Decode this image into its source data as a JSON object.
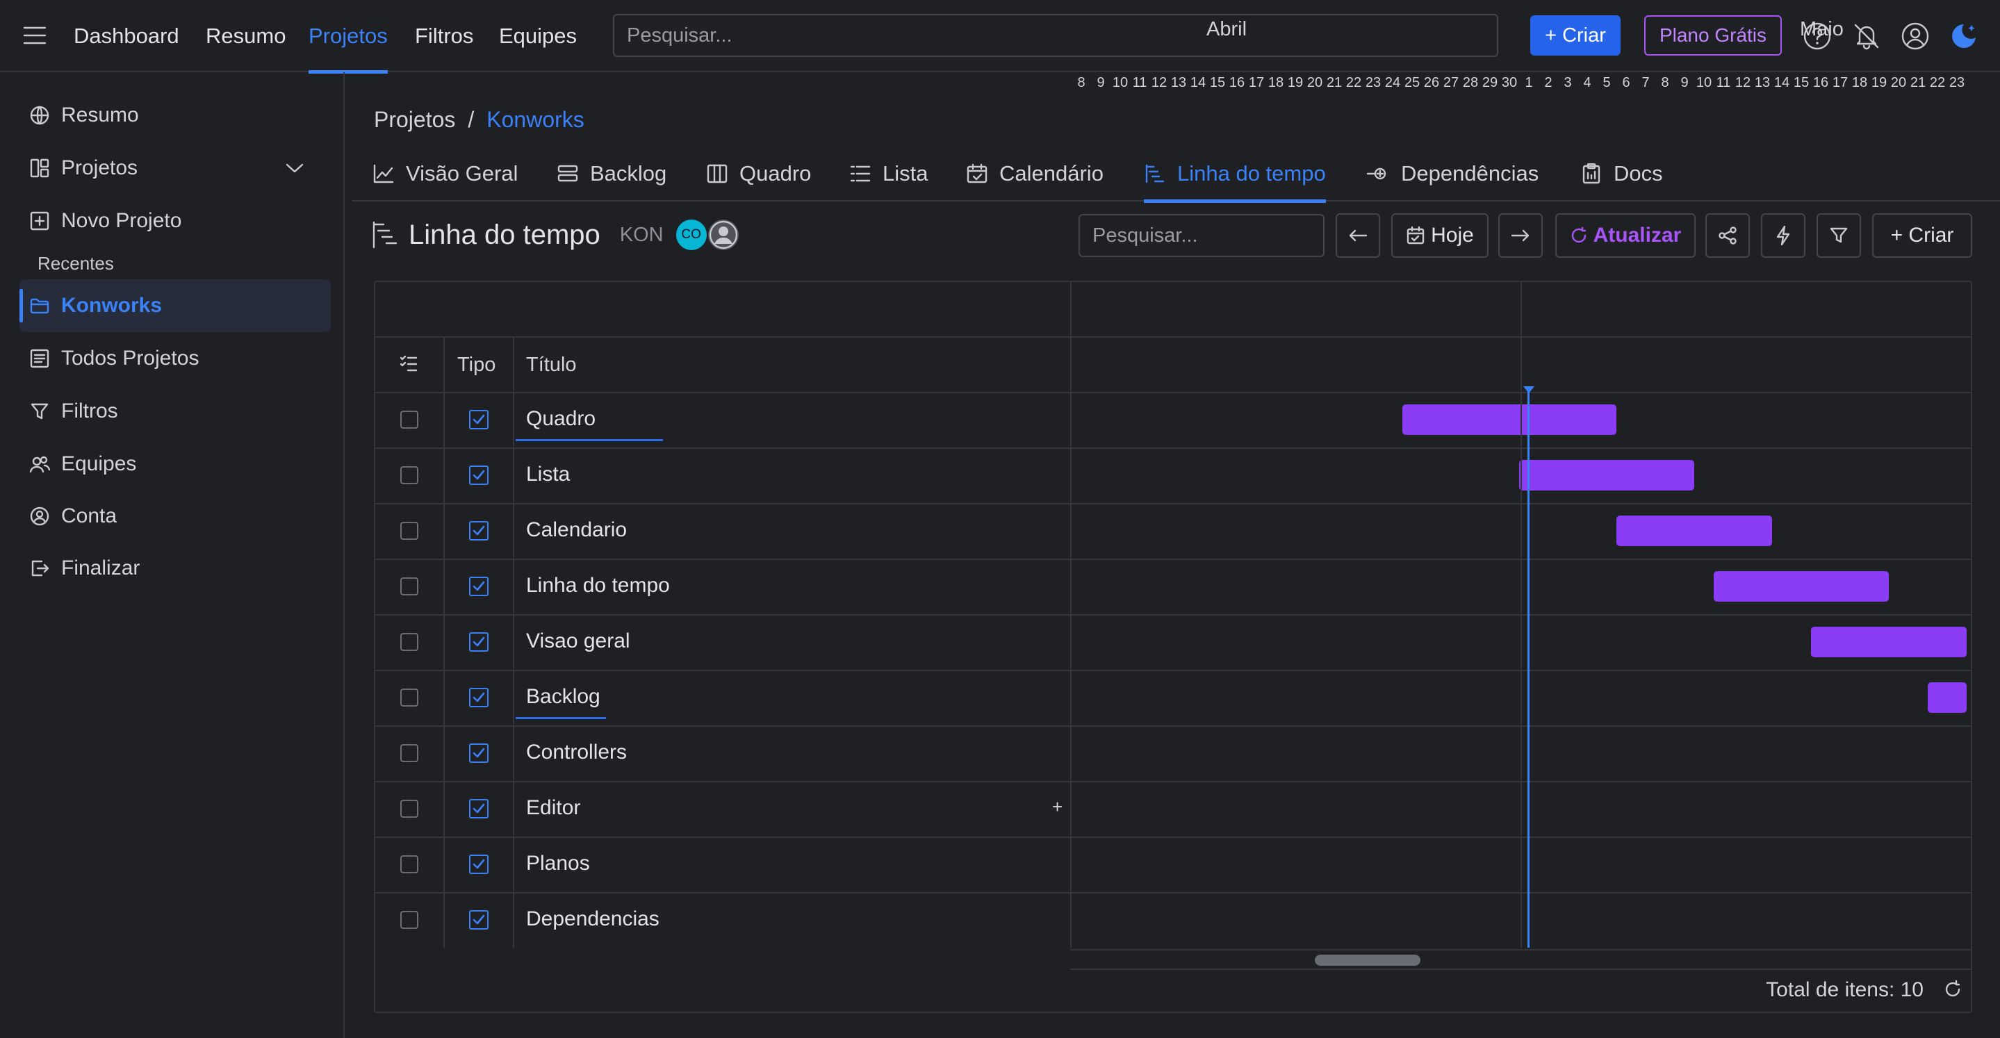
{
  "topbar": {
    "nav": [
      "Dashboard",
      "Resumo",
      "Projetos",
      "Filtros",
      "Equipes"
    ],
    "active_nav": "Projetos",
    "search_placeholder": "Pesquisar...",
    "create_label": "+ Criar",
    "plan_label": "Plano Grátis",
    "icons": [
      "help-icon",
      "notifications-off-icon",
      "user-icon",
      "theme-toggle-icon"
    ]
  },
  "sidebar": {
    "items": [
      {
        "label": "Resumo",
        "icon": "globe-icon"
      },
      {
        "label": "Projetos",
        "icon": "layout-icon"
      },
      {
        "label": "Novo Projeto",
        "icon": "plus-square-icon"
      },
      {
        "label": "Konworks",
        "icon": "folder-icon",
        "active": true
      },
      {
        "label": "Todos Projetos",
        "icon": "list-icon"
      },
      {
        "label": "Filtros",
        "icon": "filter-icon"
      },
      {
        "label": "Equipes",
        "icon": "users-icon"
      },
      {
        "label": "Conta",
        "icon": "user-circle-icon"
      },
      {
        "label": "Finalizar",
        "icon": "logout-icon"
      }
    ],
    "section_recentes": "Recentes"
  },
  "breadcrumb": {
    "root": "Projetos",
    "separator": "/",
    "current": "Konworks"
  },
  "tabs": [
    {
      "label": "Visão Geral",
      "icon": "chart-icon"
    },
    {
      "label": "Backlog",
      "icon": "backlog-icon"
    },
    {
      "label": "Quadro",
      "icon": "columns-icon"
    },
    {
      "label": "Lista",
      "icon": "list-icon"
    },
    {
      "label": "Calendário",
      "icon": "calendar-icon"
    },
    {
      "label": "Linha do tempo",
      "icon": "timeline-icon",
      "active": true
    },
    {
      "label": "Dependências",
      "icon": "dependency-icon"
    },
    {
      "label": "Docs",
      "icon": "docs-icon"
    }
  ],
  "view": {
    "title": "Linha do tempo",
    "key": "KON",
    "avatar_initials": "CO",
    "search_placeholder": "Pesquisar...",
    "today_label": "Hoje",
    "refresh_label": "Atualizar",
    "create_label": "+ Criar"
  },
  "grid": {
    "col_type": "Tipo",
    "col_title": "Título",
    "months": [
      {
        "name": "Abril",
        "days": [
          "8",
          "9",
          "10",
          "11",
          "12",
          "13",
          "14",
          "15",
          "16",
          "17",
          "18",
          "19",
          "20",
          "21",
          "22",
          "23",
          "24",
          "25",
          "26",
          "27",
          "28",
          "29",
          "30"
        ]
      },
      {
        "name": "Maio",
        "days": [
          "1",
          "2",
          "3",
          "4",
          "5",
          "6",
          "7",
          "8",
          "9",
          "10",
          "11",
          "12",
          "13",
          "14",
          "15",
          "16",
          "17",
          "18",
          "19",
          "20",
          "21",
          "22",
          "23"
        ]
      }
    ],
    "today": "2024-05-01",
    "rows": [
      {
        "title": "Quadro",
        "start": "2024-04-25",
        "end": "2024-05-05"
      },
      {
        "title": "Lista",
        "start": "2024-05-01",
        "end": "2024-05-09"
      },
      {
        "title": "Calendario",
        "start": "2024-05-06",
        "end": "2024-05-13"
      },
      {
        "title": "Linha do tempo",
        "start": "2024-05-11",
        "end": "2024-05-19"
      },
      {
        "title": "Visao geral",
        "start": "2024-05-16",
        "end": "2024-05-23"
      },
      {
        "title": "Backlog",
        "start": "2024-05-22",
        "end": "2024-05-23"
      },
      {
        "title": "Controllers"
      },
      {
        "title": "Editor"
      },
      {
        "title": "Planos"
      },
      {
        "title": "Dependencias"
      }
    ],
    "total_label": "Total de itens: 10"
  }
}
